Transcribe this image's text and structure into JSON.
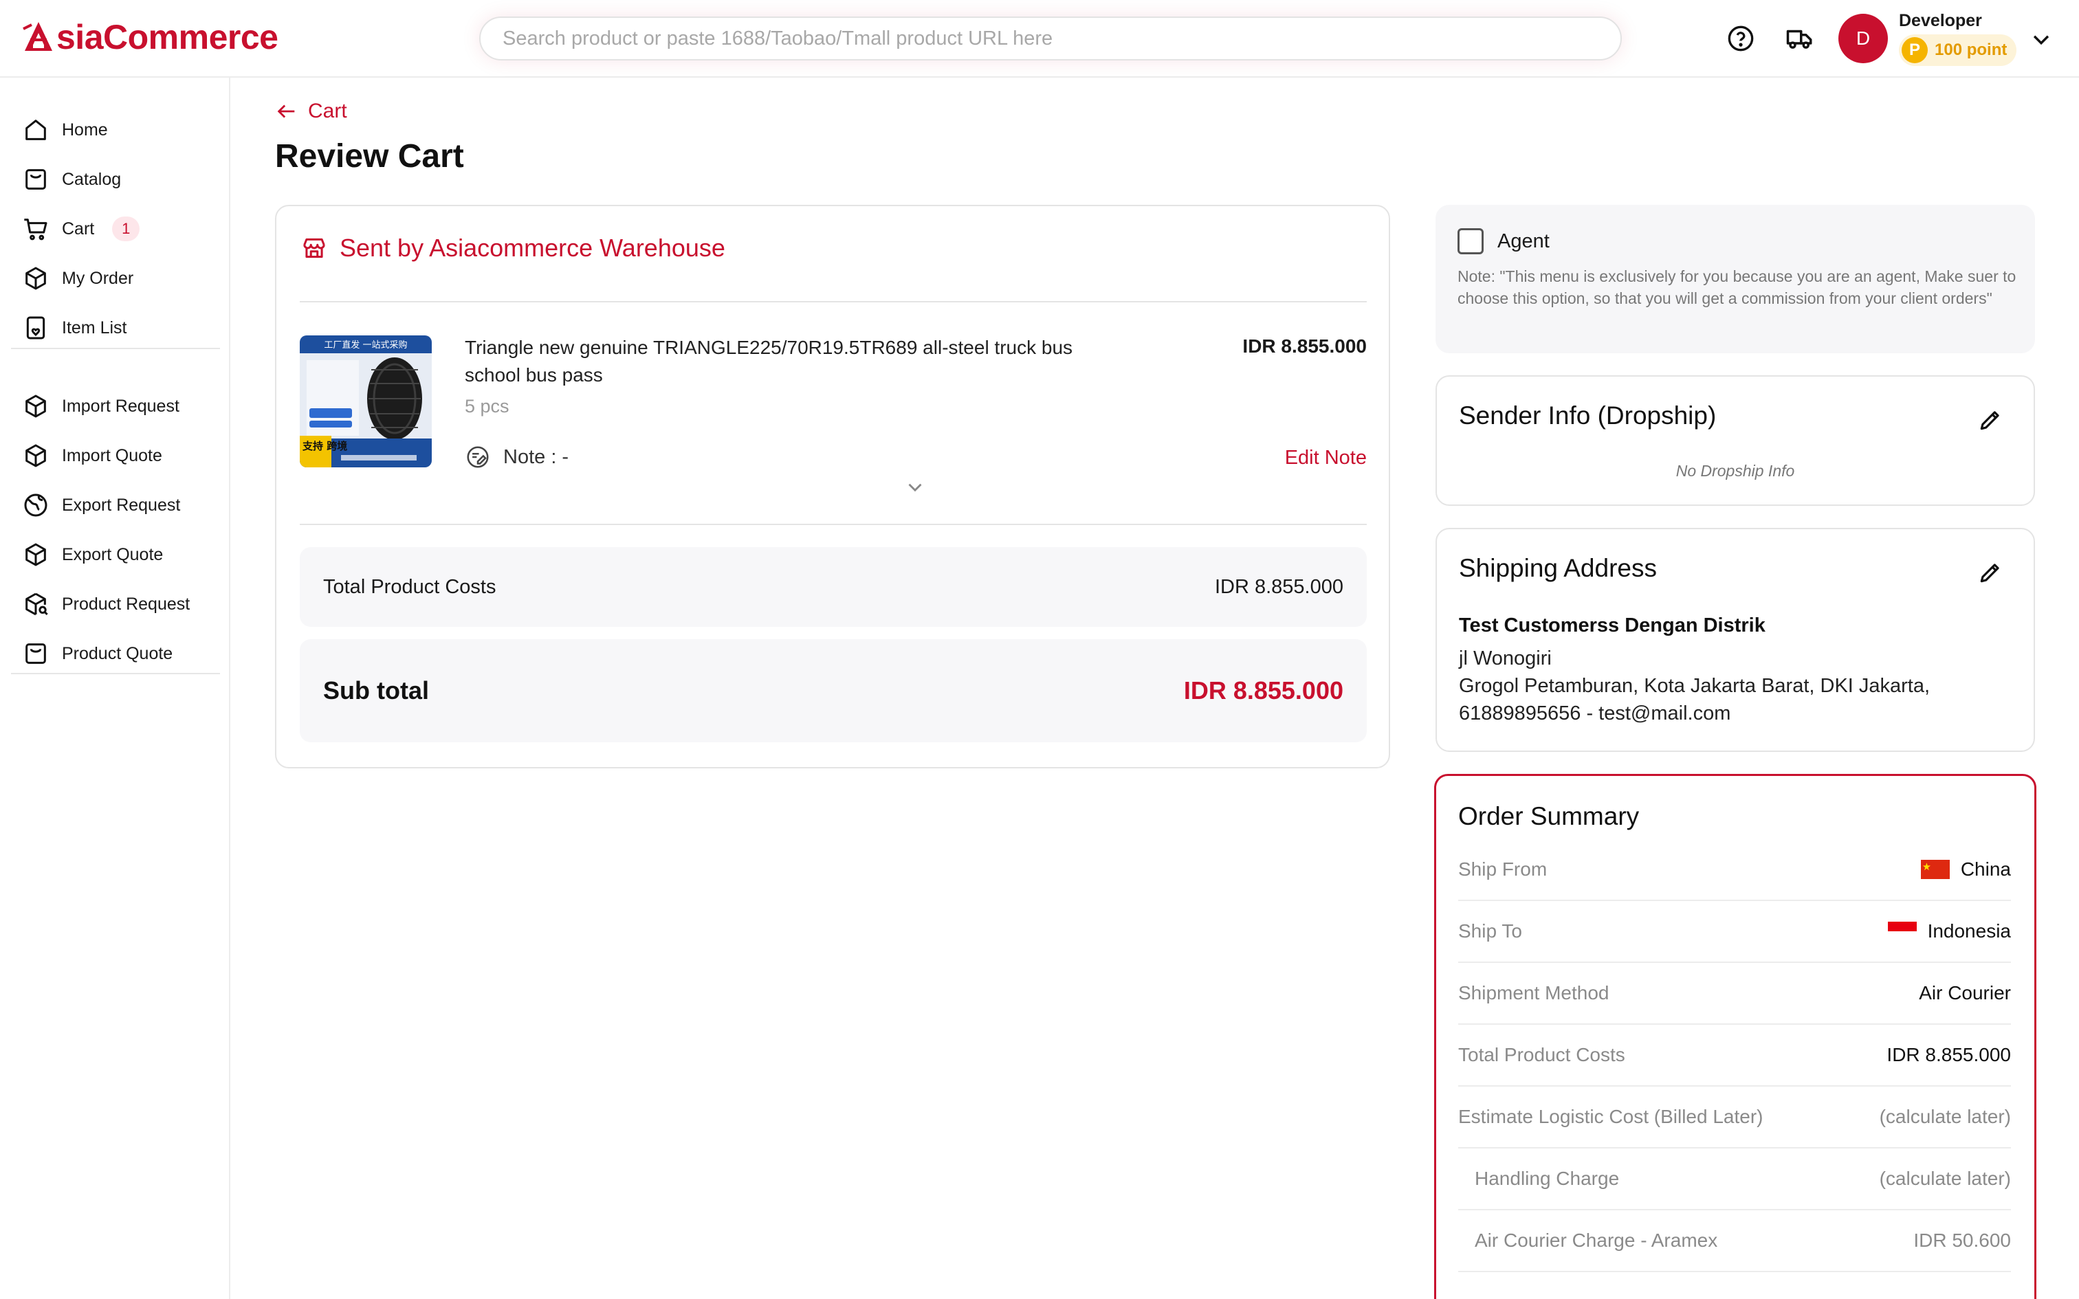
{
  "header": {
    "logo_text": "siaCommerce",
    "search_placeholder": "Search product or paste 1688/Taobao/Tmall product URL here",
    "help_icon": "help-circle-icon",
    "truck_icon": "delivery-truck-icon",
    "avatar_initial": "D",
    "user_name": "Developer",
    "points_coin": "P",
    "points_label": "100 point"
  },
  "sidebar": {
    "items": [
      {
        "label": "Home",
        "icon": "home-icon"
      },
      {
        "label": "Catalog",
        "icon": "catalog-icon"
      },
      {
        "label": "Cart",
        "icon": "cart-icon",
        "badge": "1"
      },
      {
        "label": "My Order",
        "icon": "box-icon"
      },
      {
        "label": "Item List",
        "icon": "item-list-icon"
      },
      {
        "label": "Import Request",
        "icon": "box-icon"
      },
      {
        "label": "Import Quote",
        "icon": "box-icon"
      },
      {
        "label": "Export Request",
        "icon": "globe-icon"
      },
      {
        "label": "Export Quote",
        "icon": "box-icon"
      },
      {
        "label": "Product Request",
        "icon": "box-search-icon"
      },
      {
        "label": "Product Quote",
        "icon": "catalog-icon"
      }
    ]
  },
  "main": {
    "back_label": "Cart",
    "page_title": "Review Cart",
    "warehouse_label": "Sent by Asiacommerce Warehouse",
    "product": {
      "title": "Triangle new genuine TRIANGLE225/70R19.5TR689 all-steel truck bus school bus pass",
      "qty": "5 pcs",
      "price": "IDR 8.855.000",
      "note": "Note : -",
      "edit_note": "Edit Note",
      "image_banner": "工厂直发 一站式采购",
      "image_side_text": "支持 跨境"
    },
    "total_product_costs_label": "Total Product Costs",
    "total_product_costs_value": "IDR 8.855.000",
    "subtotal_label": "Sub total",
    "subtotal_value": "IDR 8.855.000"
  },
  "agent": {
    "label": "Agent",
    "note": "Note: \"This menu is exclusively for you because you are an agent, Make suer to choose this option, so that you will get a commission from your client orders\""
  },
  "sender": {
    "title": "Sender Info (Dropship)",
    "empty": "No Dropship Info"
  },
  "shipping": {
    "title": "Shipping Address",
    "name": "Test Customerss Dengan Distrik",
    "line1": "jl Wonogiri",
    "line2": "Grogol Petamburan, Kota Jakarta Barat, DKI Jakarta,",
    "line3": "61889895656 - test@mail.com"
  },
  "summary": {
    "title": "Order Summary",
    "rows": [
      {
        "label": "Ship From",
        "value": "China",
        "flag": "china-flag-icon"
      },
      {
        "label": "Ship To",
        "value": "Indonesia",
        "flag": "indonesia-flag-icon"
      },
      {
        "label": "Shipment Method",
        "value": "Air Courier"
      },
      {
        "label": "Total Product Costs",
        "value": "IDR 8.855.000"
      },
      {
        "label": "Estimate Logistic Cost (Billed Later)",
        "value": "(calculate later)"
      },
      {
        "label": "Handling Charge",
        "value": "(calculate later)"
      },
      {
        "label": "Air Courier Charge - Aramex",
        "value": "IDR 50.600"
      }
    ]
  },
  "colors": {
    "brand": "#c8102e",
    "points_bg": "#fdf3d8",
    "points_text": "#e39b00"
  }
}
